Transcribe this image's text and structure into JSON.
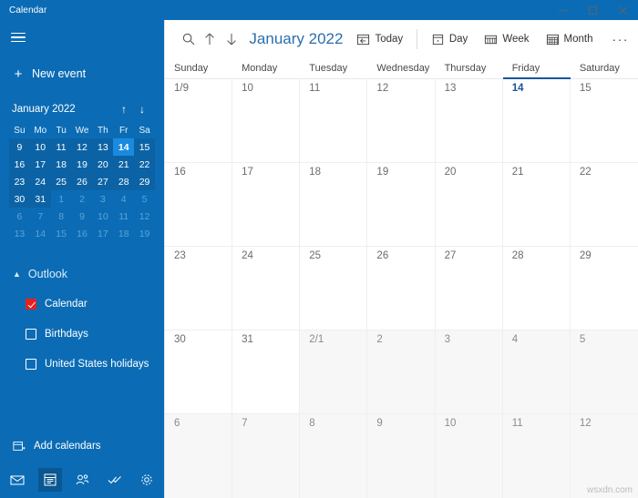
{
  "window": {
    "title": "Calendar",
    "controls": [
      {
        "name": "minimize",
        "glyph": "minimize-icon"
      },
      {
        "name": "maximize",
        "glyph": "maximize-icon"
      },
      {
        "name": "close",
        "glyph": "close-icon"
      }
    ]
  },
  "colors": {
    "sidebar_blue": "#0b6cb5",
    "sidebar_shade": "#0b63a5",
    "selected_day": "#1a8ae0",
    "title_accent": "#2a6fad",
    "today_underline": "#18559c",
    "checkbox_checked": "#e62020",
    "other_month_cell": "#f7f7f7"
  },
  "sidebar": {
    "menu_icon": "hamburger-icon",
    "new_event": {
      "label": "New event",
      "icon": "plus-icon"
    },
    "mini_calendar": {
      "month_label": "January 2022",
      "prev_icon": "arrow-up-icon",
      "next_icon": "arrow-down-icon",
      "weekday_headers": [
        "Su",
        "Mo",
        "Tu",
        "We",
        "Th",
        "Fr",
        "Sa"
      ],
      "weeks": [
        [
          {
            "d": "9",
            "out": false,
            "sel": false
          },
          {
            "d": "10",
            "out": false,
            "sel": false
          },
          {
            "d": "11",
            "out": false,
            "sel": false
          },
          {
            "d": "12",
            "out": false,
            "sel": false
          },
          {
            "d": "13",
            "out": false,
            "sel": false
          },
          {
            "d": "14",
            "out": false,
            "sel": true
          },
          {
            "d": "15",
            "out": false,
            "sel": false
          }
        ],
        [
          {
            "d": "16",
            "out": false,
            "sel": false
          },
          {
            "d": "17",
            "out": false,
            "sel": false
          },
          {
            "d": "18",
            "out": false,
            "sel": false
          },
          {
            "d": "19",
            "out": false,
            "sel": false
          },
          {
            "d": "20",
            "out": false,
            "sel": false
          },
          {
            "d": "21",
            "out": false,
            "sel": false
          },
          {
            "d": "22",
            "out": false,
            "sel": false
          }
        ],
        [
          {
            "d": "23",
            "out": false,
            "sel": false
          },
          {
            "d": "24",
            "out": false,
            "sel": false
          },
          {
            "d": "25",
            "out": false,
            "sel": false
          },
          {
            "d": "26",
            "out": false,
            "sel": false
          },
          {
            "d": "27",
            "out": false,
            "sel": false
          },
          {
            "d": "28",
            "out": false,
            "sel": false
          },
          {
            "d": "29",
            "out": false,
            "sel": false
          }
        ],
        [
          {
            "d": "30",
            "out": false,
            "sel": false
          },
          {
            "d": "31",
            "out": false,
            "sel": false
          },
          {
            "d": "1",
            "out": true,
            "sel": false
          },
          {
            "d": "2",
            "out": true,
            "sel": false
          },
          {
            "d": "3",
            "out": true,
            "sel": false
          },
          {
            "d": "4",
            "out": true,
            "sel": false
          },
          {
            "d": "5",
            "out": true,
            "sel": false
          }
        ],
        [
          {
            "d": "6",
            "out": true,
            "sel": false
          },
          {
            "d": "7",
            "out": true,
            "sel": false
          },
          {
            "d": "8",
            "out": true,
            "sel": false
          },
          {
            "d": "9",
            "out": true,
            "sel": false
          },
          {
            "d": "10",
            "out": true,
            "sel": false
          },
          {
            "d": "11",
            "out": true,
            "sel": false
          },
          {
            "d": "12",
            "out": true,
            "sel": false
          }
        ],
        [
          {
            "d": "13",
            "out": true,
            "sel": false
          },
          {
            "d": "14",
            "out": true,
            "sel": false
          },
          {
            "d": "15",
            "out": true,
            "sel": false
          },
          {
            "d": "16",
            "out": true,
            "sel": false
          },
          {
            "d": "17",
            "out": true,
            "sel": false
          },
          {
            "d": "18",
            "out": true,
            "sel": false
          },
          {
            "d": "19",
            "out": true,
            "sel": false
          }
        ]
      ]
    },
    "account": {
      "name": "Outlook",
      "expanded": true,
      "collapse_icon": "chevron-up-icon",
      "calendars": [
        {
          "label": "Calendar",
          "checked": true
        },
        {
          "label": "Birthdays",
          "checked": false
        },
        {
          "label": "United States holidays",
          "checked": false
        }
      ]
    },
    "add_calendars": {
      "label": "Add calendars",
      "icon": "calendar-add-icon"
    },
    "app_bar": [
      {
        "name": "mail",
        "icon": "mail-icon",
        "active": false
      },
      {
        "name": "calendar",
        "icon": "calendar-icon",
        "active": true
      },
      {
        "name": "people",
        "icon": "people-icon",
        "active": false
      },
      {
        "name": "todo",
        "icon": "todo-check-icon",
        "active": false
      },
      {
        "name": "settings",
        "icon": "gear-icon",
        "active": false
      }
    ]
  },
  "toolbar": {
    "search_icon": "search-icon",
    "prev_icon": "arrow-up-icon",
    "next_icon": "arrow-down-icon",
    "title": "January 2022",
    "today_label": "Today",
    "views": [
      {
        "label": "Day",
        "icon": "day-view-icon",
        "active": false
      },
      {
        "label": "Week",
        "icon": "week-view-icon",
        "active": false
      },
      {
        "label": "Month",
        "icon": "month-view-icon",
        "active": true
      }
    ],
    "overflow_label": "···"
  },
  "calendar": {
    "weekday_headers": [
      {
        "label": "Sunday",
        "today": false
      },
      {
        "label": "Monday",
        "today": false
      },
      {
        "label": "Tuesday",
        "today": false
      },
      {
        "label": "Wednesday",
        "today": false
      },
      {
        "label": "Thursday",
        "today": false
      },
      {
        "label": "Friday",
        "today": true
      },
      {
        "label": "Saturday",
        "today": false
      }
    ],
    "weeks": [
      [
        {
          "label": "1/9",
          "other": false,
          "today": false
        },
        {
          "label": "10",
          "other": false,
          "today": false
        },
        {
          "label": "11",
          "other": false,
          "today": false
        },
        {
          "label": "12",
          "other": false,
          "today": false
        },
        {
          "label": "13",
          "other": false,
          "today": false
        },
        {
          "label": "14",
          "other": false,
          "today": true
        },
        {
          "label": "15",
          "other": false,
          "today": false
        }
      ],
      [
        {
          "label": "16",
          "other": false,
          "today": false
        },
        {
          "label": "17",
          "other": false,
          "today": false
        },
        {
          "label": "18",
          "other": false,
          "today": false
        },
        {
          "label": "19",
          "other": false,
          "today": false
        },
        {
          "label": "20",
          "other": false,
          "today": false
        },
        {
          "label": "21",
          "other": false,
          "today": false
        },
        {
          "label": "22",
          "other": false,
          "today": false
        }
      ],
      [
        {
          "label": "23",
          "other": false,
          "today": false
        },
        {
          "label": "24",
          "other": false,
          "today": false
        },
        {
          "label": "25",
          "other": false,
          "today": false
        },
        {
          "label": "26",
          "other": false,
          "today": false
        },
        {
          "label": "27",
          "other": false,
          "today": false
        },
        {
          "label": "28",
          "other": false,
          "today": false
        },
        {
          "label": "29",
          "other": false,
          "today": false
        }
      ],
      [
        {
          "label": "30",
          "other": false,
          "today": false
        },
        {
          "label": "31",
          "other": false,
          "today": false
        },
        {
          "label": "2/1",
          "other": true,
          "today": false
        },
        {
          "label": "2",
          "other": true,
          "today": false
        },
        {
          "label": "3",
          "other": true,
          "today": false
        },
        {
          "label": "4",
          "other": true,
          "today": false
        },
        {
          "label": "5",
          "other": true,
          "today": false
        }
      ],
      [
        {
          "label": "6",
          "other": true,
          "today": false
        },
        {
          "label": "7",
          "other": true,
          "today": false
        },
        {
          "label": "8",
          "other": true,
          "today": false
        },
        {
          "label": "9",
          "other": true,
          "today": false
        },
        {
          "label": "10",
          "other": true,
          "today": false
        },
        {
          "label": "11",
          "other": true,
          "today": false
        },
        {
          "label": "12",
          "other": true,
          "today": false
        }
      ]
    ],
    "watermark": "wsxdn.com"
  }
}
